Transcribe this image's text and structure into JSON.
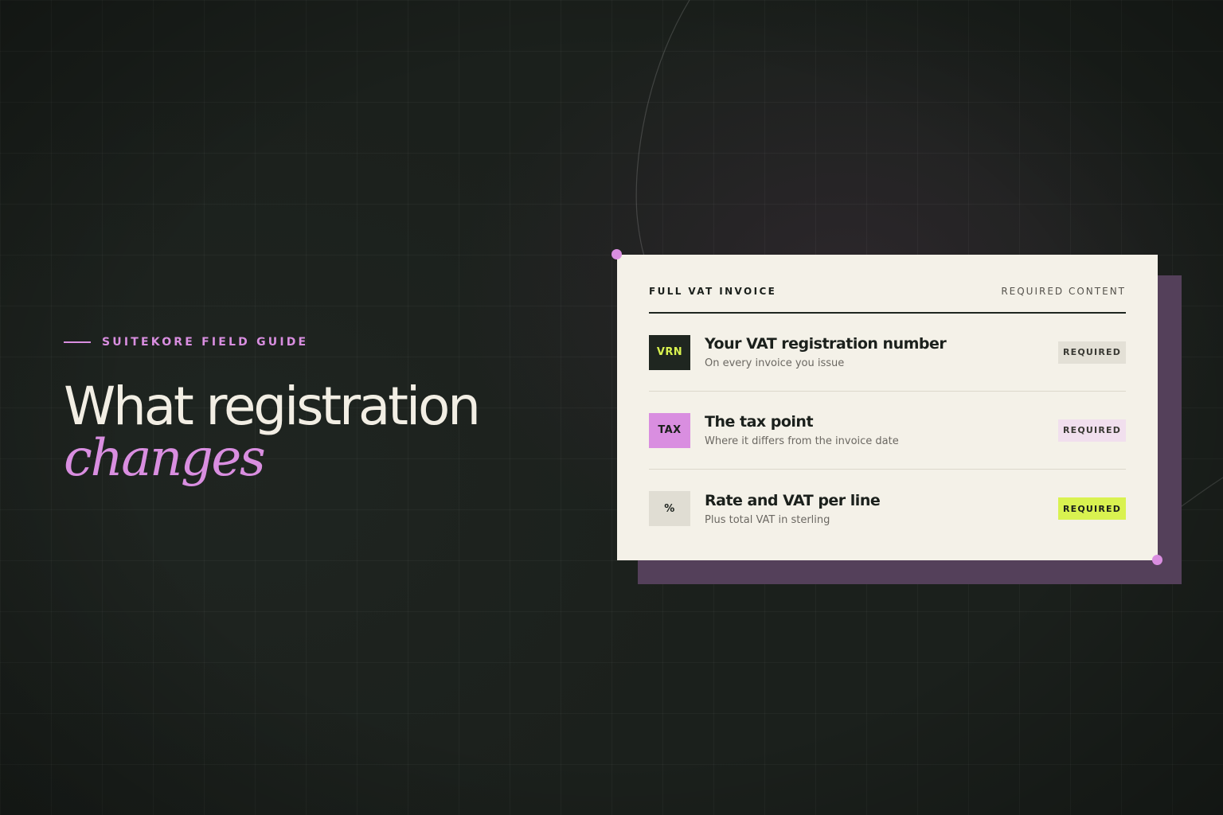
{
  "hero": {
    "eyebrow": "SUITEKORE FIELD GUIDE",
    "headline": "What registration",
    "headline_accent": "changes"
  },
  "card": {
    "title": "FULL VAT INVOICE",
    "label": "REQUIRED CONTENT",
    "items": [
      {
        "tag": "VRN",
        "title": "Your VAT registration number",
        "subtitle": "On every invoice you issue",
        "badge": "REQUIRED"
      },
      {
        "tag": "TAX",
        "title": "The tax point",
        "subtitle": "Where it differs from the invoice date",
        "badge": "REQUIRED"
      },
      {
        "tag": "%",
        "title": "Rate and VAT per line",
        "subtitle": "Plus total VAT in sterling",
        "badge": "REQUIRED"
      }
    ]
  },
  "colors": {
    "background": "#1b201c",
    "accent_pink": "#d98ee0",
    "accent_lime": "#d9f250",
    "card": "#f4f1e8",
    "card_shadow": "#54405a"
  }
}
